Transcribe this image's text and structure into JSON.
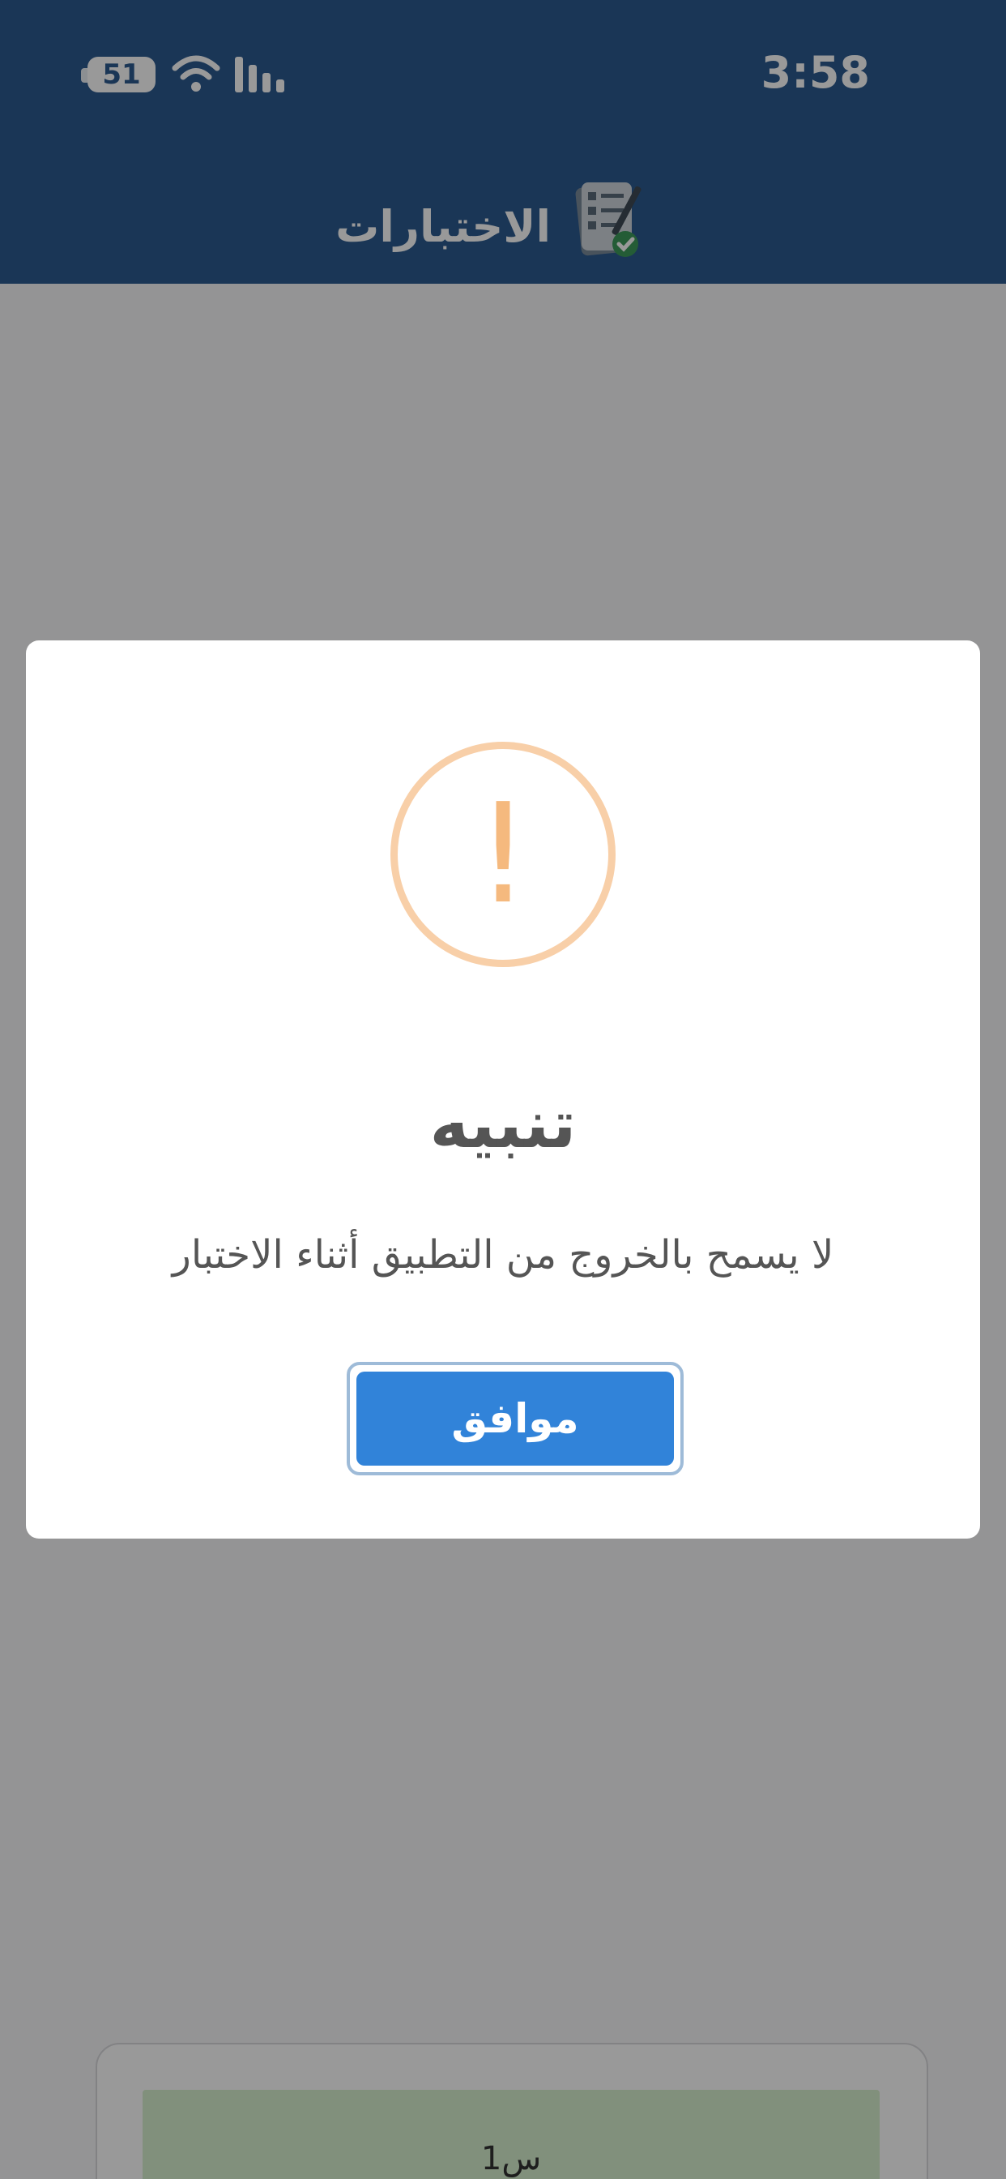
{
  "status_bar": {
    "time": "3:58",
    "battery_level": "51"
  },
  "header": {
    "title": "الاختبارات",
    "icon": "exam-checklist-icon",
    "background_color": "#2c5a8f"
  },
  "background_content": {
    "question_label": "س1"
  },
  "alert": {
    "icon": "warning-icon",
    "icon_color": "#f5b97e",
    "title": "تنبيه",
    "message": "لا يسمح بالخروج من التطبيق أثناء الاختبار",
    "confirm_label": "موافق",
    "confirm_color": "#3183d9"
  }
}
